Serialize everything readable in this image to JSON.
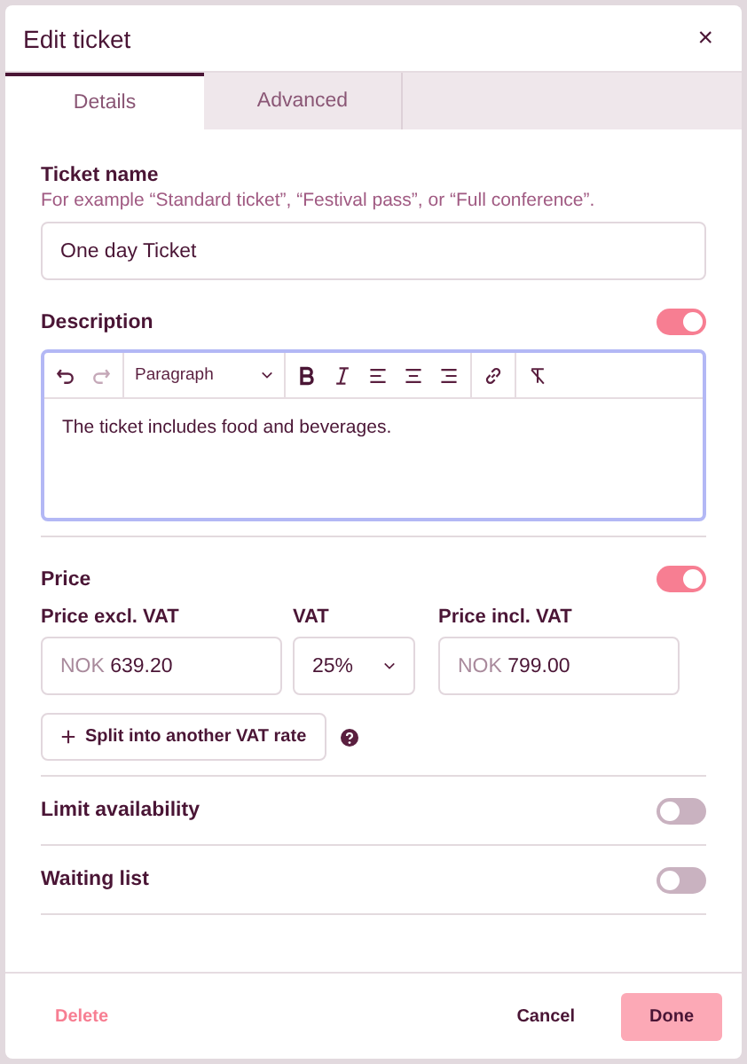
{
  "dialog": {
    "title": "Edit ticket",
    "close": "×"
  },
  "tabs": [
    {
      "label": "Details",
      "selected": true
    },
    {
      "label": "Advanced",
      "selected": false
    }
  ],
  "ticket_name": {
    "label": "Ticket name",
    "hint": "For example “Standard ticket”, “Festival pass”, or “Full conference”.",
    "value": "One day Ticket"
  },
  "description": {
    "label": "Description",
    "on": true,
    "block_format": "Paragraph",
    "text": "The ticket includes food and beverages."
  },
  "price": {
    "label": "Price",
    "on": true,
    "fields": [
      {
        "label": "Price excl. VAT",
        "kind": "amount",
        "currency": "NOK",
        "value": "639.20"
      },
      {
        "label": "VAT",
        "kind": "select",
        "value": "25%"
      },
      {
        "label": "Price incl. VAT",
        "kind": "amount",
        "currency": "NOK",
        "value": "799.00"
      }
    ],
    "split_button": "Split into another VAT rate"
  },
  "settings": [
    {
      "label": "Limit availability",
      "on": false
    },
    {
      "label": "Waiting list",
      "on": false
    }
  ],
  "footer": {
    "delete": "Delete",
    "cancel": "Cancel",
    "done": "Done"
  }
}
